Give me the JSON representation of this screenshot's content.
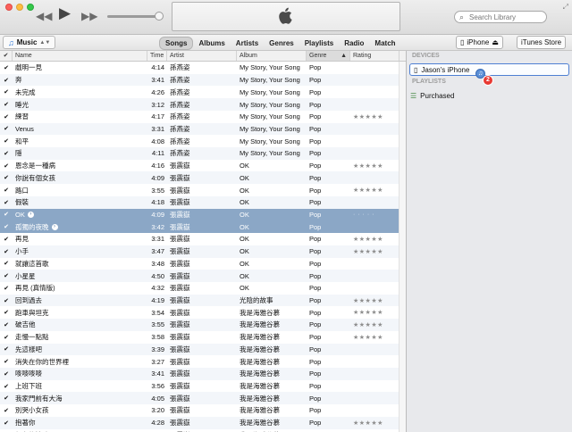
{
  "window": {
    "search_placeholder": "Search Library",
    "lcd_logo": "apple-logo"
  },
  "nav": {
    "library_selector": "Music",
    "tabs": [
      {
        "label": "Songs",
        "active": true
      },
      {
        "label": "Albums",
        "active": false
      },
      {
        "label": "Artists",
        "active": false
      },
      {
        "label": "Genres",
        "active": false
      },
      {
        "label": "Playlists",
        "active": false
      },
      {
        "label": "Radio",
        "active": false
      },
      {
        "label": "Match",
        "active": false
      }
    ],
    "device_button": "iPhone",
    "store_button": "iTunes Store"
  },
  "table": {
    "columns": {
      "check": "✔",
      "name": "Name",
      "time": "Time",
      "artist": "Artist",
      "album": "Album",
      "genre": "Genre",
      "rating": "Rating"
    },
    "rows": [
      {
        "name": "戲明一見",
        "time": "4:14",
        "artist": "孫燕姿",
        "album": "My Story, Your Song",
        "genre": "Pop",
        "rating": "",
        "selected": false
      },
      {
        "name": "奔",
        "time": "3:41",
        "artist": "孫燕姿",
        "album": "My Story, Your Song",
        "genre": "Pop",
        "rating": "",
        "selected": false
      },
      {
        "name": "未完成",
        "time": "4:26",
        "artist": "孫燕姿",
        "album": "My Story, Your Song",
        "genre": "Pop",
        "rating": "",
        "selected": false
      },
      {
        "name": "睡光",
        "time": "3:12",
        "artist": "孫燕姿",
        "album": "My Story, Your Song",
        "genre": "Pop",
        "rating": "",
        "selected": false
      },
      {
        "name": "練習",
        "time": "4:17",
        "artist": "孫燕姿",
        "album": "My Story, Your Song",
        "genre": "Pop",
        "rating": "★★★★★",
        "selected": false
      },
      {
        "name": "Venus",
        "time": "3:31",
        "artist": "孫燕姿",
        "album": "My Story, Your Song",
        "genre": "Pop",
        "rating": "",
        "selected": false
      },
      {
        "name": "和平",
        "time": "4:08",
        "artist": "孫燕姿",
        "album": "My Story, Your Song",
        "genre": "Pop",
        "rating": "",
        "selected": false
      },
      {
        "name": "隱",
        "time": "4:11",
        "artist": "孫燕姿",
        "album": "My Story, Your Song",
        "genre": "Pop",
        "rating": "",
        "selected": false
      },
      {
        "name": "恩念是一種病",
        "time": "4:16",
        "artist": "張震嶽",
        "album": "OK",
        "genre": "Pop",
        "rating": "★★★★★",
        "selected": false
      },
      {
        "name": "你說有個女孩",
        "time": "4:09",
        "artist": "張震嶽",
        "album": "OK",
        "genre": "Pop",
        "rating": "",
        "selected": false
      },
      {
        "name": "路口",
        "time": "3:55",
        "artist": "張震嶽",
        "album": "OK",
        "genre": "Pop",
        "rating": "★★★★★",
        "selected": false
      },
      {
        "name": "假裝",
        "time": "4:18",
        "artist": "張震嶽",
        "album": "OK",
        "genre": "Pop",
        "rating": "",
        "selected": false
      },
      {
        "name": "OK",
        "time": "4:09",
        "artist": "張震嶽",
        "album": "OK",
        "genre": "Pop",
        "rating": "· · · · ·",
        "selected": true
      },
      {
        "name": "孤獨的夜晚",
        "time": "3:42",
        "artist": "張震嶽",
        "album": "OK",
        "genre": "Pop",
        "rating": "",
        "selected": true
      },
      {
        "name": "再見",
        "time": "3:31",
        "artist": "張震嶽",
        "album": "OK",
        "genre": "Pop",
        "rating": "★★★★★",
        "selected": false
      },
      {
        "name": "小手",
        "time": "3:47",
        "artist": "張震嶽",
        "album": "OK",
        "genre": "Pop",
        "rating": "★★★★★",
        "selected": false
      },
      {
        "name": "就讓這首歌",
        "time": "3:48",
        "artist": "張震嶽",
        "album": "OK",
        "genre": "Pop",
        "rating": "",
        "selected": false
      },
      {
        "name": "小星星",
        "time": "4:50",
        "artist": "張震嶽",
        "album": "OK",
        "genre": "Pop",
        "rating": "",
        "selected": false
      },
      {
        "name": "再見 (真情版)",
        "time": "4:32",
        "artist": "張震嶽",
        "album": "OK",
        "genre": "Pop",
        "rating": "",
        "selected": false
      },
      {
        "name": "回到過去",
        "time": "4:19",
        "artist": "張震嶽",
        "album": "光陰的故事",
        "genre": "Pop",
        "rating": "★★★★★",
        "selected": false
      },
      {
        "name": "跑車與坦克",
        "time": "3:54",
        "artist": "張震嶽",
        "album": "我是海雅谷慕",
        "genre": "Pop",
        "rating": "★★★★★",
        "selected": false
      },
      {
        "name": "破吉他",
        "time": "3:55",
        "artist": "張震嶽",
        "album": "我是海雅谷慕",
        "genre": "Pop",
        "rating": "★★★★★",
        "selected": false
      },
      {
        "name": "走慢一點點",
        "time": "3:58",
        "artist": "張震嶽",
        "album": "我是海雅谷慕",
        "genre": "Pop",
        "rating": "★★★★★",
        "selected": false
      },
      {
        "name": "先這樣吧",
        "time": "3:39",
        "artist": "張震嶽",
        "album": "我是海雅谷慕",
        "genre": "Pop",
        "rating": "",
        "selected": false
      },
      {
        "name": "消失在你的世界裡",
        "time": "3:27",
        "artist": "張震嶽",
        "album": "我是海雅谷慕",
        "genre": "Pop",
        "rating": "",
        "selected": false
      },
      {
        "name": "嘜嘜嘜嘜",
        "time": "3:41",
        "artist": "張震嶽",
        "album": "我是海雅谷慕",
        "genre": "Pop",
        "rating": "",
        "selected": false
      },
      {
        "name": "上班下班",
        "time": "3:56",
        "artist": "張震嶽",
        "album": "我是海雅谷慕",
        "genre": "Pop",
        "rating": "",
        "selected": false
      },
      {
        "name": "我家門前有大海",
        "time": "4:05",
        "artist": "張震嶽",
        "album": "我是海雅谷慕",
        "genre": "Pop",
        "rating": "",
        "selected": false
      },
      {
        "name": "別哭小女孩",
        "time": "3:20",
        "artist": "張震嶽",
        "album": "我是海雅谷慕",
        "genre": "Pop",
        "rating": "",
        "selected": false
      },
      {
        "name": "抱著你",
        "time": "4:28",
        "artist": "張震嶽",
        "album": "我是海雅谷慕",
        "genre": "Pop",
        "rating": "★★★★★",
        "selected": false
      },
      {
        "name": "無名的情歌",
        "time": "4:04",
        "artist": "張震嶽",
        "album": "我是海雅谷慕",
        "genre": "Pop",
        "rating": "",
        "selected": false
      }
    ]
  },
  "sidebar": {
    "devices_header": "DEVICES",
    "device_name": "Jason's iPhone",
    "sync_count": "2",
    "playlists_header": "PLAYLISTS",
    "playlists": [
      {
        "label": "Purchased"
      }
    ]
  },
  "colors": {
    "selected_row": "#8ba7c6",
    "device_border": "#4e7fd3",
    "badge_red": "#e83a33"
  }
}
